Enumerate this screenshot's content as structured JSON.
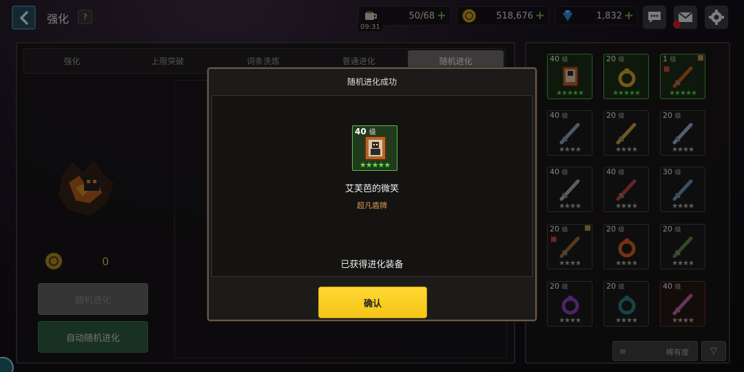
{
  "header": {
    "title": "强化",
    "help": "?",
    "energy": {
      "value": "50/68",
      "timer": "09:31",
      "icon": "coffee-cup-icon"
    },
    "gold": {
      "value": "518,676",
      "icon": "gold-coin-icon"
    },
    "gems": {
      "value": "1,832",
      "icon": "blue-diamond-icon"
    },
    "buttons": [
      "chat-icon",
      "mail-icon",
      "gear-icon"
    ]
  },
  "tabs": [
    {
      "label": "强化",
      "active": false
    },
    {
      "label": "上限突破",
      "active": false
    },
    {
      "label": "词条洗炼",
      "active": false
    },
    {
      "label": "普通进化",
      "active": false
    },
    {
      "label": "随机进化",
      "active": true
    }
  ],
  "left": {
    "coin_value": "0",
    "random_button": "随机进化",
    "auto_button": "自动随机进化"
  },
  "inventory": {
    "slots": [
      {
        "level": "40",
        "unit": "级",
        "stars": "★★★★★",
        "rarity": "green",
        "icon": "framed-portrait-icon"
      },
      {
        "level": "20",
        "unit": "级",
        "stars": "★★★★★",
        "rarity": "green",
        "icon": "blue-ring-icon"
      },
      {
        "level": "1",
        "unit": "级",
        "stars": "★★★★★",
        "rarity": "green",
        "icon": "flame-sword-icon",
        "locked": true,
        "flag": true
      },
      {
        "level": "40",
        "unit": "级",
        "stars": "★★★★",
        "rarity": "gray",
        "icon": "spiked-blade-icon"
      },
      {
        "level": "20",
        "unit": "级",
        "stars": "★★★★",
        "rarity": "gray",
        "icon": "golden-dagger-icon"
      },
      {
        "level": "20",
        "unit": "级",
        "stars": "★★★★",
        "rarity": "gray",
        "icon": "crystal-blade-icon"
      },
      {
        "level": "40",
        "unit": "级",
        "stars": "★★★★",
        "rarity": "gray",
        "icon": "short-sword-icon"
      },
      {
        "level": "40",
        "unit": "级",
        "stars": "★★★★",
        "rarity": "gray",
        "icon": "red-sword-icon"
      },
      {
        "level": "30",
        "unit": "级",
        "stars": "★★★★",
        "rarity": "gray",
        "icon": "ice-axe-icon"
      },
      {
        "level": "20",
        "unit": "级",
        "stars": "★★★★",
        "rarity": "gray",
        "icon": "wooden-bow-icon",
        "locked": true,
        "flag": true
      },
      {
        "level": "20",
        "unit": "级",
        "stars": "★★★★",
        "rarity": "gray",
        "icon": "ember-amulet-icon"
      },
      {
        "level": "20",
        "unit": "级",
        "stars": "★★★★",
        "rarity": "gray",
        "icon": "orb-staff-icon"
      },
      {
        "level": "20",
        "unit": "级",
        "stars": "★★★★",
        "rarity": "gray",
        "icon": "purple-ring-icon"
      },
      {
        "level": "20",
        "unit": "级",
        "stars": "★★★★",
        "rarity": "gray",
        "icon": "dark-ring-icon"
      },
      {
        "level": "40",
        "unit": "级",
        "stars": "★★★★",
        "rarity": "red",
        "icon": "pink-staff-icon"
      }
    ],
    "sort_label": "稀有度",
    "sort_lines": "≡",
    "filter_icon": "▽"
  },
  "dialog": {
    "title": "随机进化成功",
    "item": {
      "level": "40",
      "unit": "级",
      "stars": "★★★★★",
      "name": "艾芙芭的微笑",
      "type": "超凡盾牌",
      "icon": "framed-portrait-icon"
    },
    "message": "已获得进化装备",
    "confirm": "确认"
  },
  "colors": {
    "accent_yellow": "#F5C518",
    "rarity_green": "#5CC246",
    "type_orange": "#D49955",
    "gem_blue": "#2E8BE6",
    "gold": "#C9A030"
  }
}
